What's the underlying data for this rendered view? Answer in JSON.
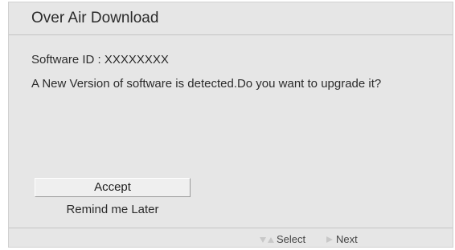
{
  "dialog": {
    "title": "Over Air Download",
    "software_id": "Software ID : XXXXXXXX",
    "message": "A New Version of software is detected.Do you want to upgrade it?"
  },
  "buttons": {
    "accept": "Accept",
    "remind": "Remind me Later"
  },
  "footer": {
    "select_icon": "up-down-arrows-icon",
    "select_label": "Select",
    "next_icon": "right-arrow-icon",
    "next_label": "Next"
  },
  "colors": {
    "background": "#e6e6e6",
    "button": "#efefef",
    "text": "#2b2b2b",
    "icon": "#c8c8c8"
  }
}
